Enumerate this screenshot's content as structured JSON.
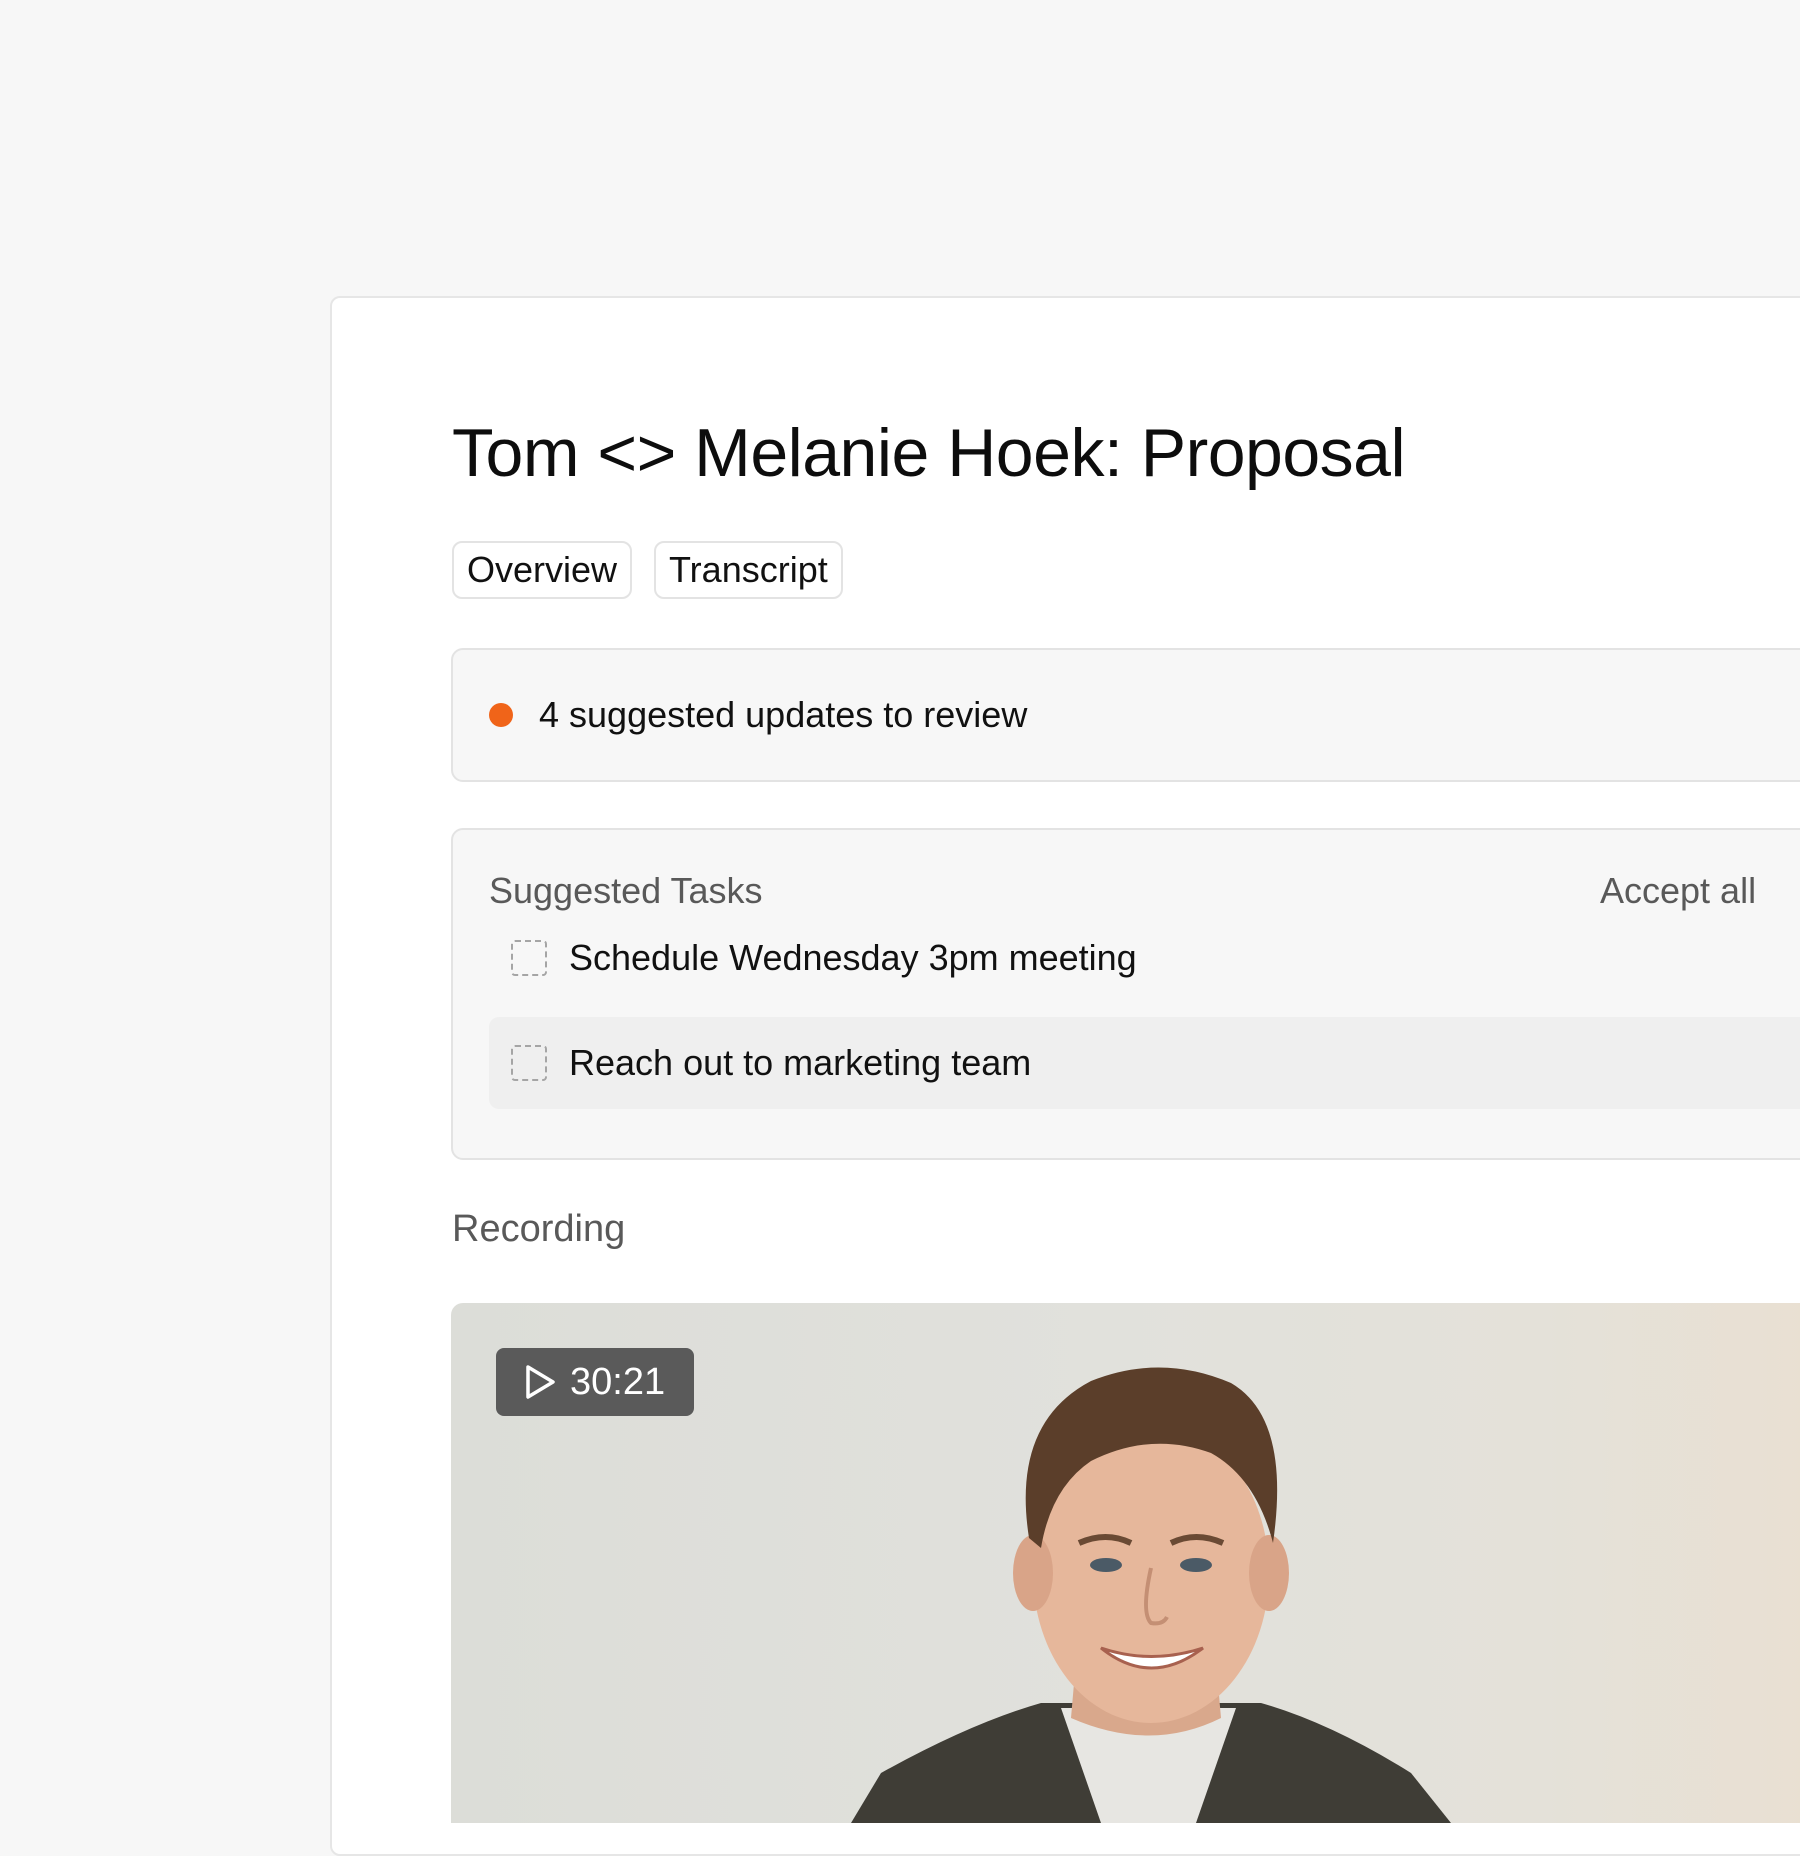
{
  "meeting": {
    "title": "Tom <> Melanie Hoek: Proposal"
  },
  "tabs": [
    {
      "label": "Overview"
    },
    {
      "label": "Transcript"
    }
  ],
  "updates_banner": {
    "text": "4 suggested updates to review",
    "dot_color": "#f06419"
  },
  "suggested_tasks": {
    "heading": "Suggested Tasks",
    "accept_all_label": "Accept all",
    "items": [
      {
        "label": "Schedule Wednesday 3pm meeting",
        "checked": false
      },
      {
        "label": "Reach out to marketing team",
        "checked": false,
        "hovered": true
      }
    ]
  },
  "recording": {
    "heading": "Recording",
    "duration": "30:21",
    "play_icon": "play-icon"
  }
}
